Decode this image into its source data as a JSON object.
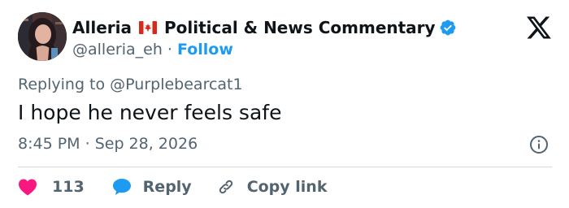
{
  "author": {
    "display_name": "Alleria",
    "name_suffix": "Political & News Commentary",
    "handle": "@alleria_eh",
    "separator": "·",
    "follow_label": "Follow"
  },
  "reply_context": {
    "prefix": "Replying to",
    "target": "@Purplebearcat1"
  },
  "tweet": {
    "text": "I hope he never feels safe",
    "time": "8:45 PM",
    "separator": "·",
    "date": "Sep 28, 2026"
  },
  "actions": {
    "like_count": "113",
    "reply_label": "Reply",
    "copy_link_label": "Copy link"
  },
  "colors": {
    "accent": "#1d9bf0",
    "like": "#f91880",
    "text_primary": "#0f1419",
    "text_secondary": "#536471",
    "divider": "#cfd9de"
  },
  "icons": {
    "flag": "canada-flag-icon",
    "verified": "verified-badge-icon",
    "logo": "x-logo-icon",
    "info": "info-icon",
    "like": "heart-icon",
    "reply": "speech-bubble-icon",
    "copy": "link-icon"
  }
}
